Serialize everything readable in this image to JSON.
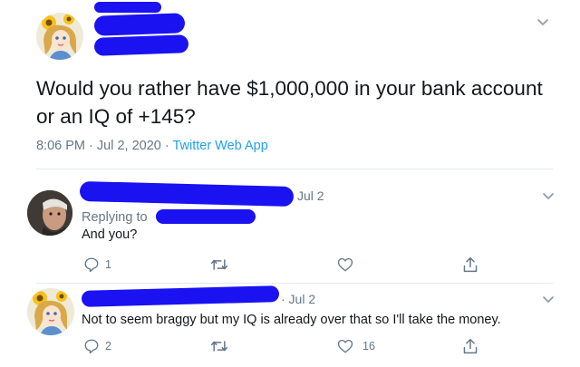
{
  "main_tweet": {
    "text_line1": "Would you rather have $1,000,000 in your bank account",
    "text_line2": "or an IQ of +145?",
    "time": "8:06 PM · Jul 2, 2020 · ",
    "source": "Twitter Web App"
  },
  "replies": [
    {
      "date": "Jul 2",
      "replying_to_label": "Replying to",
      "text": "And you?",
      "reply_count": "1",
      "retweet_count": "",
      "like_count": ""
    },
    {
      "date": "· Jul 2",
      "text": "Not to seem braggy but my IQ is already over that so I'll take the money.",
      "reply_count": "2",
      "retweet_count": "",
      "like_count": "16"
    }
  ],
  "icons": {
    "more": "chevron-down-icon",
    "reply": "reply-icon",
    "retweet": "retweet-icon",
    "like": "heart-icon",
    "share": "share-icon"
  },
  "colors": {
    "redaction": "#1a12f0",
    "link": "#1da1f2",
    "muted": "#657786"
  }
}
